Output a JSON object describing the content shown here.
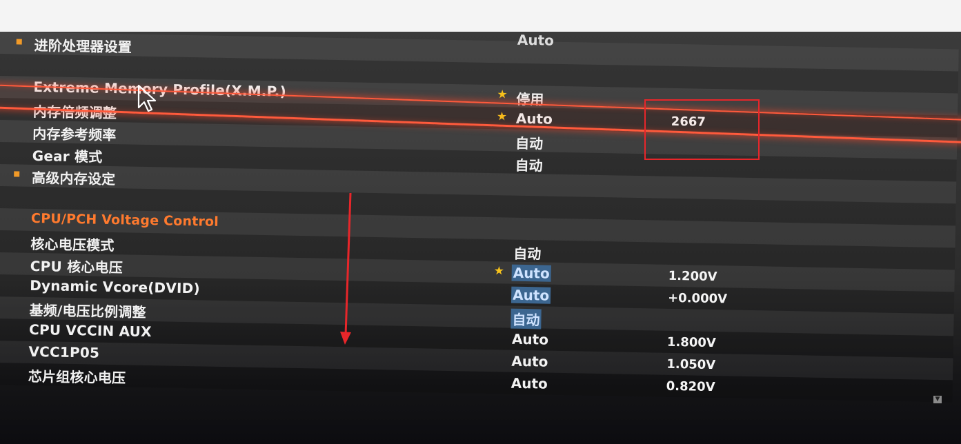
{
  "top_partial_value": "Auto",
  "rows": [
    {
      "label": "进阶处理器设置",
      "bullet": true
    },
    {
      "label": ""
    },
    {
      "label": "Extreme Memory Profile(X.M.P.)",
      "value": "停用",
      "star": true
    },
    {
      "label": "内存倍频调整",
      "value": "Auto",
      "star": true,
      "value2": "2667"
    },
    {
      "label": "内存参考频率",
      "value": "自动"
    },
    {
      "label": "Gear 模式",
      "value": "自动"
    },
    {
      "label": "高级内存设定",
      "bullet": true
    },
    {
      "label": ""
    },
    {
      "label": "CPU/PCH Voltage Control",
      "section": true
    },
    {
      "label": "核心电压模式",
      "value": "自动"
    },
    {
      "label": "CPU 核心电压",
      "value": "Auto",
      "star": true,
      "value2": "1.200V",
      "highlight": true
    },
    {
      "label": "Dynamic Vcore(DVID)",
      "value": "Auto",
      "value2": "+0.000V",
      "highlight": true
    },
    {
      "label": "基频/电压比例调整",
      "value": "自动",
      "highlight": true
    },
    {
      "label": "CPU VCCIN AUX",
      "value": "Auto",
      "value2": "1.800V"
    },
    {
      "label": "VCC1P05",
      "value": "Auto",
      "value2": "1.050V"
    },
    {
      "label": "芯片组核心电压",
      "value": "Auto",
      "value2": "0.820V"
    }
  ],
  "colors": {
    "section_header": "#ff7a2e",
    "bullet": "#f19a28",
    "star": "#f7c31c",
    "selection": "#3c6690",
    "annotation_red": "#e8262a",
    "xmp_glow": "#ff5a3c"
  },
  "icons": [
    "star-icon",
    "mouse-cursor-icon",
    "scroll-down-icon",
    "annotation-arrow"
  ]
}
